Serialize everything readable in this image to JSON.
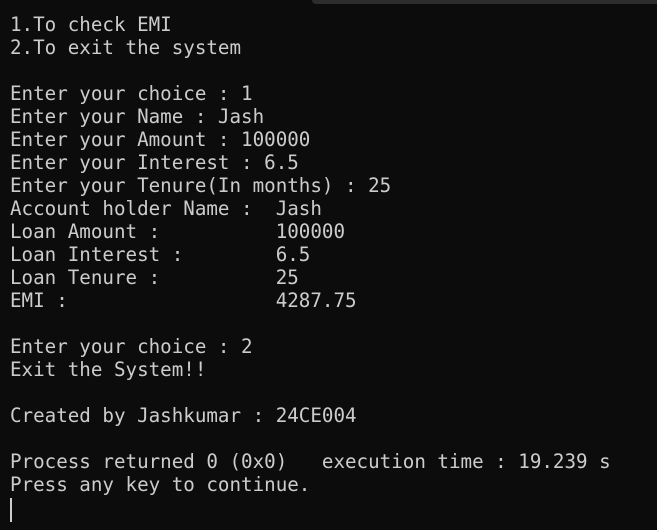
{
  "console": {
    "lines": [
      "1.To check EMI",
      "2.To exit the system",
      "",
      "Enter your choice : 1",
      "Enter your Name : Jash",
      "Enter your Amount : 100000",
      "Enter your Interest : 6.5",
      "Enter your Tenure(In months) : 25",
      "Account holder Name :  Jash",
      "Loan Amount :          100000",
      "Loan Interest :        6.5",
      "Loan Tenure :          25",
      "EMI :                  4287.75",
      "",
      "Enter your choice : 2",
      "Exit the System!!",
      "",
      "Created by Jashkumar : 24CE004",
      "",
      "Process returned 0 (0x0)   execution time : 19.239 s",
      "Press any key to continue."
    ]
  }
}
